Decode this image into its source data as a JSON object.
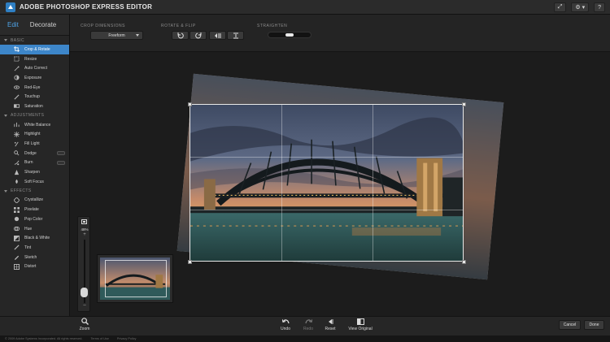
{
  "window": {
    "title": "ADOBE PHOTOSHOP EXPRESS EDITOR",
    "logo_icon": "photoshop-express-logo-icon",
    "right_controls": [
      {
        "icon": "feather-icon",
        "label": "⤢"
      },
      {
        "icon": "gear-icon",
        "label": "⚙ ▾"
      },
      {
        "icon": "help-icon",
        "label": "?"
      }
    ]
  },
  "modes": {
    "edit": "Edit",
    "decorate": "Decorate"
  },
  "sections": [
    {
      "title": "BASIC",
      "tools": [
        {
          "label": "Crop & Rotate",
          "icon": "crop-icon",
          "selected": true
        },
        {
          "label": "Resize",
          "icon": "resize-icon"
        },
        {
          "label": "Auto Correct",
          "icon": "wand-icon"
        },
        {
          "label": "Exposure",
          "icon": "exposure-icon"
        },
        {
          "label": "Red-Eye",
          "icon": "eye-icon"
        },
        {
          "label": "Touchup",
          "icon": "brush-icon"
        },
        {
          "label": "Saturation",
          "icon": "saturation-icon"
        }
      ]
    },
    {
      "title": "ADJUSTMENTS",
      "tools": [
        {
          "label": "White Balance",
          "icon": "white-balance-icon"
        },
        {
          "label": "Highlight",
          "icon": "highlight-icon"
        },
        {
          "label": "Fill Light",
          "icon": "fill-light-icon"
        },
        {
          "label": "Dodge",
          "icon": "dodge-icon",
          "toggle": true
        },
        {
          "label": "Burn",
          "icon": "burn-icon",
          "toggle": true
        },
        {
          "label": "Sharpen",
          "icon": "sharpen-icon"
        },
        {
          "label": "Soft Focus",
          "icon": "soft-focus-icon"
        }
      ]
    },
    {
      "title": "EFFECTS",
      "tools": [
        {
          "label": "Crystallize",
          "icon": "crystallize-icon"
        },
        {
          "label": "Pixelate",
          "icon": "pixelate-icon"
        },
        {
          "label": "Pop Color",
          "icon": "pop-color-icon"
        },
        {
          "label": "Hue",
          "icon": "hue-icon"
        },
        {
          "label": "Black & White",
          "icon": "black-white-icon"
        },
        {
          "label": "Tint",
          "icon": "tint-icon"
        },
        {
          "label": "Sketch",
          "icon": "sketch-icon"
        },
        {
          "label": "Distort",
          "icon": "distort-icon"
        }
      ]
    }
  ],
  "toolbar": {
    "crop_dimensions_label": "CROP DIMENSIONS",
    "crop_value": "Freeform",
    "rotate_flip_label": "ROTATE & FLIP",
    "straighten_label": "STRAIGHTEN",
    "straighten_level": 0.5
  },
  "zoom": {
    "percent": "48%",
    "plus": "+",
    "minus": "–",
    "label": "Zoom",
    "level": 0.1
  },
  "actions": {
    "undo": "Undo",
    "redo": "Redo",
    "reset": "Reset",
    "view_original": "View Original"
  },
  "buttons": {
    "cancel": "Cancel",
    "done": "Done"
  },
  "footer": {
    "copyright": "© 2009 Adobe Systems Incorporated. All rights reserved.",
    "terms": "Terms of Use",
    "privacy": "Privacy Policy"
  },
  "colors": {
    "accent": "#3d86c9",
    "edit_tab": "#4fa3e6",
    "background": "#1b1b1b",
    "panel": "#262626"
  }
}
